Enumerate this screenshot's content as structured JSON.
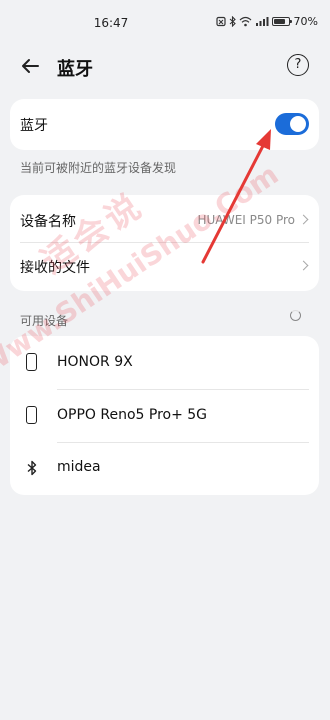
{
  "status_bar": {
    "time": "16:47",
    "battery": "70%",
    "icons": [
      "notification-icon",
      "bluetooth-icon",
      "wifi-icon",
      "signal-icon",
      "battery-icon"
    ]
  },
  "header": {
    "title": "蓝牙",
    "help": "?"
  },
  "bluetooth": {
    "label": "蓝牙",
    "enabled": true,
    "accent": "#1b6cd9"
  },
  "hint": "当前可被附近的蓝牙设备发现",
  "device_card": {
    "name_label": "设备名称",
    "name_value": "HUAWEI P50 Pro",
    "received_label": "接收的文件"
  },
  "available": {
    "label": "可用设备",
    "devices": [
      {
        "name": "HONOR 9X",
        "icon": "phone-icon"
      },
      {
        "name": "OPPO Reno5 Pro+ 5G",
        "icon": "phone-icon"
      },
      {
        "name": "midea",
        "icon": "bluetooth-icon"
      }
    ]
  },
  "watermark": {
    "brand": "适会说",
    "url": "Www.ShiHuiShuo.Com"
  },
  "annotation_color": "#e53935"
}
